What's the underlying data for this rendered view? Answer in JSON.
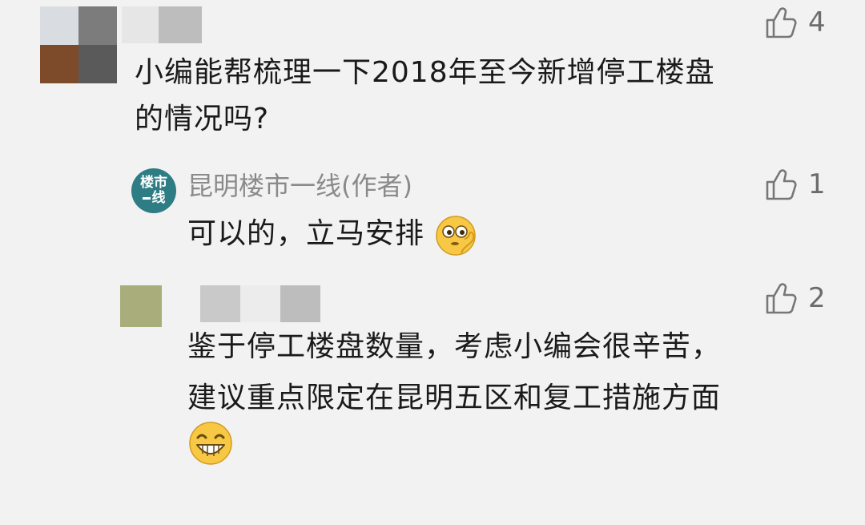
{
  "comments": [
    {
      "text_lines": [
        "小编能帮梳理一下2018年至今新增停工楼盘",
        "的情况吗?"
      ],
      "likes": "4",
      "like_icon": "thumbs-up-icon",
      "avatar": "pixelated-avatar",
      "username": "redacted"
    },
    {
      "author_badge": {
        "line1": "楼市",
        "line2": "线"
      },
      "author_name": "昆明楼市一线(作者)",
      "text_line": "可以的，立马安排",
      "emoji": "thinking-emoji",
      "likes": "1",
      "like_icon": "thumbs-up-icon"
    },
    {
      "text_lines": [
        "鉴于停工楼盘数量，考虑小编会很辛苦，",
        "建议重点限定在昆明五区和复工措施方面"
      ],
      "emoji": "grin-emoji",
      "likes": "2",
      "like_icon": "thumbs-up-icon",
      "avatar": "pixelated-avatar",
      "username": "redacted"
    }
  ],
  "colors": {
    "background": "#f2f2f2",
    "text": "#1a1a1a",
    "muted": "#8a8a8a",
    "author_badge": "#2f7d84",
    "emoji_yellow": "#f7c844"
  }
}
